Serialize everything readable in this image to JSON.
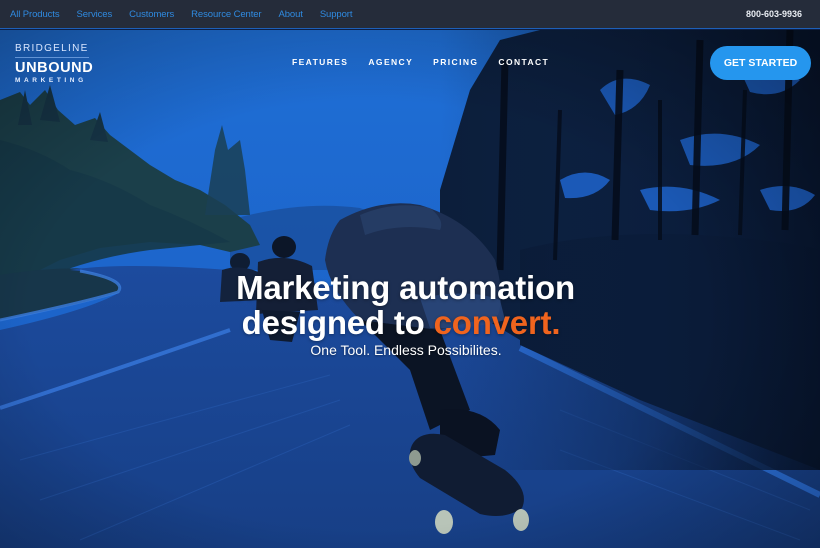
{
  "topbar": {
    "links": [
      "All Products",
      "Services",
      "Customers",
      "Resource Center",
      "About",
      "Support"
    ],
    "phone": "800-603-9936",
    "link_color": "#2f8ae0",
    "background": "#252c3a"
  },
  "logo": {
    "top": "BRIDGELINE",
    "main": "UNBOUND",
    "sub": "MARKETING"
  },
  "nav": {
    "items": [
      "FEATURES",
      "AGENCY",
      "PRICING",
      "CONTACT"
    ],
    "cta_label": "GET STARTED",
    "cta_color": "#2596ee"
  },
  "hero": {
    "headline_line1": "Marketing automation",
    "headline_line2_prefix": "designed to ",
    "headline_line2_accent": "convert.",
    "subheadline": "One Tool. Endless Possibilites.",
    "accent_color": "#f0641e",
    "background_image": "blue-tinted photo of longboard skaters riding down a winding forest road"
  }
}
